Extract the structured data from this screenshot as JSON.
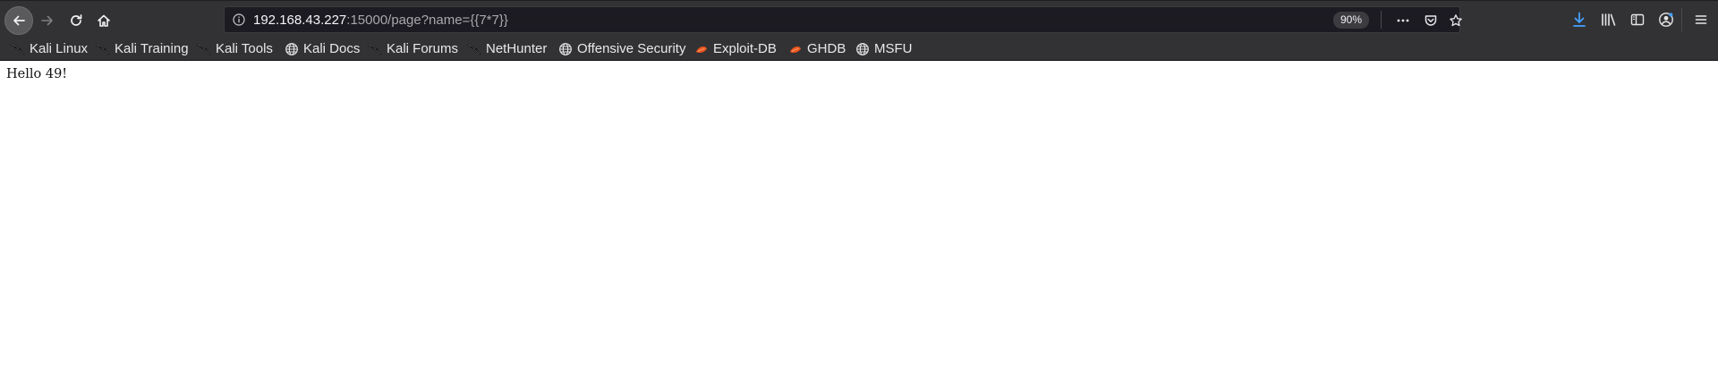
{
  "toolbar": {
    "back_icon": "arrow-left-icon",
    "forward_icon": "arrow-right-icon",
    "reload_icon": "reload-icon",
    "home_icon": "home-icon"
  },
  "url_bar": {
    "host": "192.168.43.227",
    "rest": ":15000/page?name={{7*7}}",
    "zoom": "90%",
    "info_icon": "info-icon",
    "page_actions_icon": "ellipsis-icon",
    "pocket_icon": "pocket-icon",
    "bookmark_icon": "star-icon"
  },
  "right_toolbar": {
    "downloads_icon": "download-arrow-icon",
    "downloads_color": "#45a1ff",
    "library_icon": "library-icon",
    "sidebar_icon": "sidebar-icon",
    "account_icon": "account-icon",
    "menu_icon": "hamburger-menu-icon"
  },
  "bookmarks": [
    {
      "label": "Kali Linux",
      "icon": "kali-dragon-icon"
    },
    {
      "label": "Kali Training",
      "icon": "kali-dragon-icon"
    },
    {
      "label": "Kali Tools",
      "icon": "kali-dragon-icon"
    },
    {
      "label": "Kali Docs",
      "icon": "globe-icon"
    },
    {
      "label": "Kali Forums",
      "icon": "kali-dragon-icon"
    },
    {
      "label": "NetHunter",
      "icon": "kali-dragon-icon"
    },
    {
      "label": "Offensive Security",
      "icon": "globe-icon"
    },
    {
      "label": "Exploit-DB",
      "icon": "exploit-db-icon"
    },
    {
      "label": "GHDB",
      "icon": "exploit-db-icon"
    },
    {
      "label": "MSFU",
      "icon": "globe-icon"
    }
  ],
  "page": {
    "body_text": "Hello 49!"
  },
  "colors": {
    "toolbar_bg": "#323234",
    "urlbar_bg": "#1c1b22",
    "exploit_db_accent": "#e8541c"
  }
}
